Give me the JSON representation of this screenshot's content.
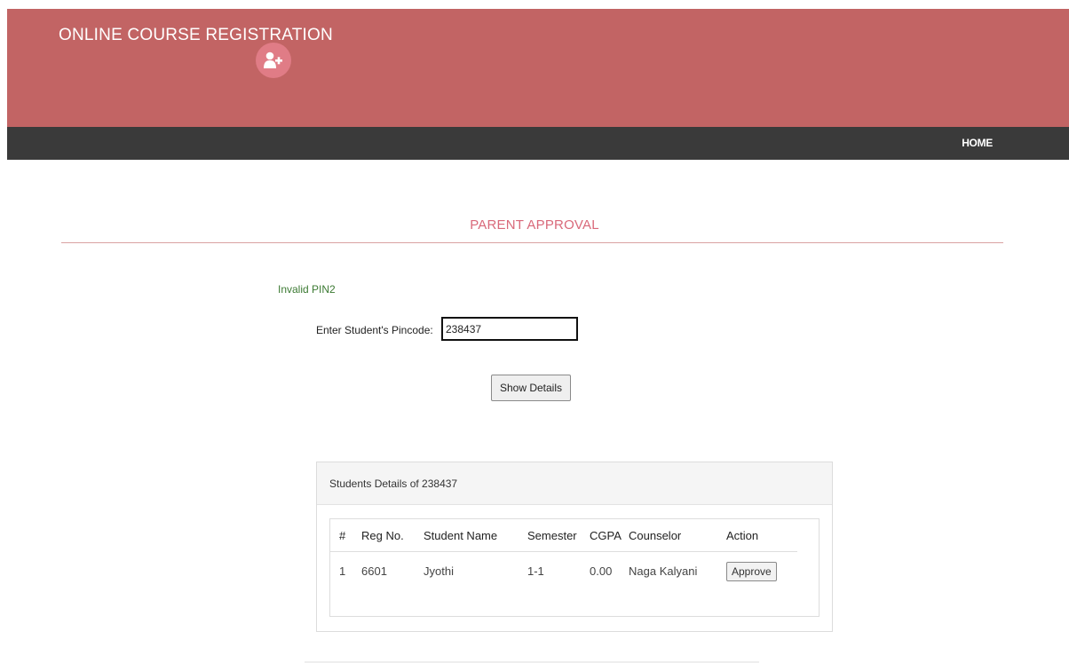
{
  "header": {
    "title": "ONLINE COURSE REGISTRATION",
    "icon": "add-user-icon",
    "background": "#c26464",
    "icon_color": "#e07c86"
  },
  "nav": {
    "home": "HOME",
    "background": "#3a3a3a"
  },
  "page": {
    "title": "PARENT APPROVAL",
    "title_color": "#d9697a"
  },
  "form": {
    "message": "Invalid PIN2",
    "message_color": "#3c7a33",
    "pincode_label": "Enter Student's Pincode:",
    "pincode_value": "238437",
    "show_button": "Show Details"
  },
  "panel": {
    "heading": "Students Details of 238437",
    "columns": [
      "#",
      "Reg No.",
      "Student Name",
      "Semester",
      "CGPA",
      "Counselor",
      "Action"
    ],
    "rows": [
      {
        "index": "1",
        "reg_no": "6601",
        "name": "Jyothi",
        "semester": "1-1",
        "cgpa": "0.00",
        "counselor": "Naga Kalyani",
        "action": "Approve"
      }
    ]
  }
}
